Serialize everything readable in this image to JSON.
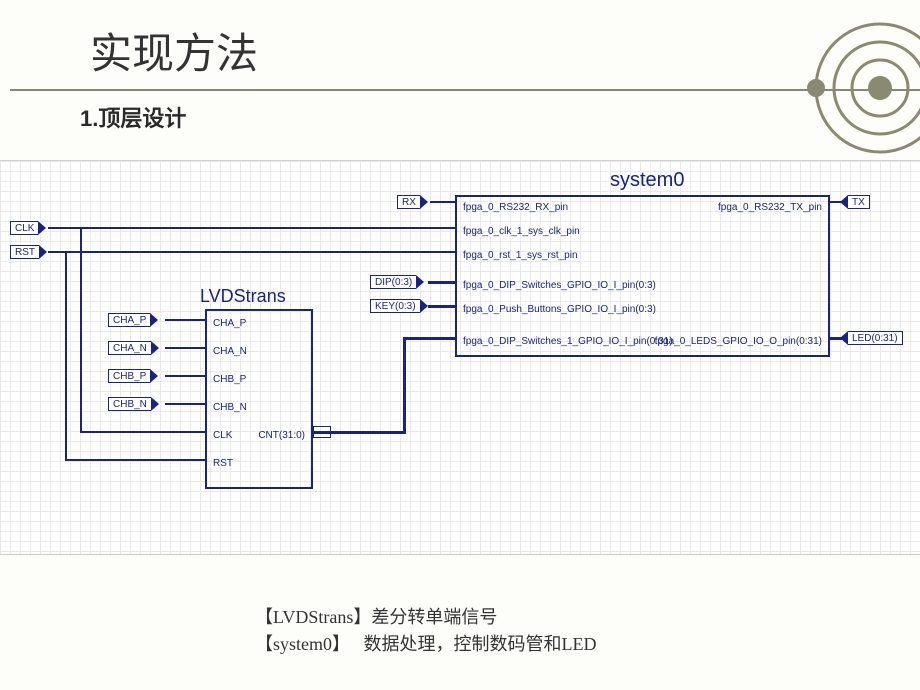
{
  "header": {
    "title": "实现方法",
    "subtitle": "1.顶层设计"
  },
  "diagram": {
    "blocks": {
      "lvds": {
        "title": "LVDStrans",
        "pins_left": [
          "CHA_P",
          "CHA_N",
          "CHB_P",
          "CHB_N",
          "CLK",
          "RST"
        ],
        "pins_right": [
          "CNT(31:0)"
        ]
      },
      "system0": {
        "title": "system0",
        "pins_left": [
          "fpga_0_RS232_RX_pin",
          "fpga_0_clk_1_sys_clk_pin",
          "fpga_0_rst_1_sys_rst_pin",
          "fpga_0_DIP_Switches_GPIO_IO_I_pin(0:3)",
          "fpga_0_Push_Buttons_GPIO_IO_I_pin(0:3)",
          "fpga_0_DIP_Switches_1_GPIO_IO_I_pin(0:31)"
        ],
        "pins_right": [
          "fpga_0_RS232_TX_pin",
          "fpga_0_LEDS_GPIO_IO_O_pin(0:31)"
        ]
      }
    },
    "io_pads": {
      "clk": "CLK",
      "rst": "RST",
      "cha_p": "CHA_P",
      "cha_n": "CHA_N",
      "chb_p": "CHB_P",
      "chb_n": "CHB_N",
      "rx": "RX",
      "dip": "DIP(0:3)",
      "key": "KEY(0:3)",
      "tx": "TX",
      "led": "LED(0:31)"
    }
  },
  "footer": {
    "line1_label": "【LVDStrans】",
    "line1_text": "差分转单端信号",
    "line2_label": "【system0】",
    "line2_text": "数据处理，控制数码管和LED"
  }
}
